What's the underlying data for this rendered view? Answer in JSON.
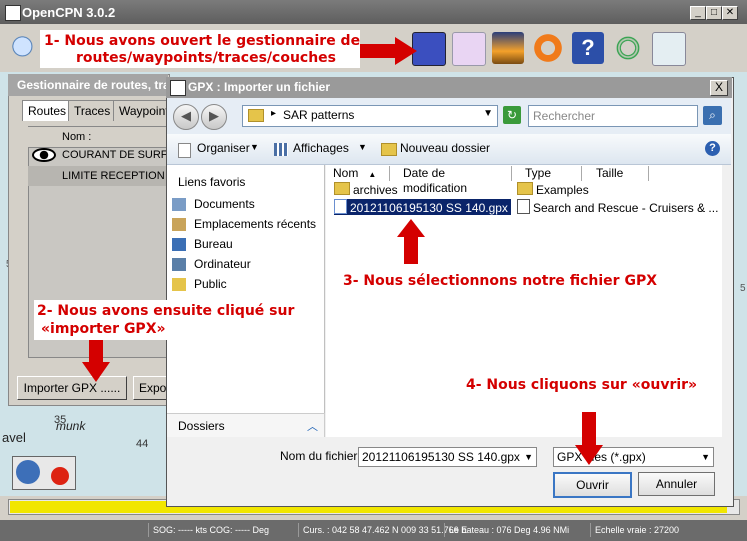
{
  "main_window": {
    "title": "OpenCPN 3.0.2",
    "chart_labels": [
      "35",
      "44",
      "avel",
      "munk",
      "5",
      "5"
    ]
  },
  "route_manager": {
    "title": "Gestionnaire de routes, tra",
    "tabs": [
      "Routes",
      "Traces",
      "Waypoint"
    ],
    "column_name": "Nom :",
    "rows": [
      "COURANT DE SURF...",
      "LIMITE RECEPTION ..."
    ],
    "import_button": "Importer GPX ......",
    "export_button": "Expo"
  },
  "dialog": {
    "title": "GPX : Importer un fichier",
    "close": "X",
    "address": "SAR patterns",
    "search_placeholder": "Rechercher",
    "commands": {
      "organize": "Organiser",
      "views": "Affichages",
      "new_folder": "Nouveau dossier"
    },
    "favorites_header": "Liens favoris",
    "favorites": [
      "Documents",
      "Emplacements récents",
      "Bureau",
      "Ordinateur",
      "Public"
    ],
    "folders_label": "Dossiers",
    "columns": [
      "Nom",
      "Date de modification",
      "Type",
      "Taille"
    ],
    "files": [
      {
        "name": "archives",
        "kind": "folder"
      },
      {
        "name": "Examples",
        "kind": "folder"
      },
      {
        "name": "20121106195130 SS 140.gpx",
        "kind": "gpx",
        "selected": true
      },
      {
        "name": "Search and Rescue - Cruisers & ...",
        "kind": "file"
      }
    ],
    "filename_label": "Nom du fichier :",
    "filename_value": "20121106195130 SS 140.gpx",
    "filetype_value": "GPX files (*.gpx)",
    "open_button": "Ouvrir",
    "cancel_button": "Annuler"
  },
  "status_bar": {
    "sog": "SOG: ----- kts  COG: ----- Deg",
    "position": "Curs. : 042 58 47.462 N 009 33 51.766 E",
    "boat": "Le  bateau : 076 Deg   4.96 NMi",
    "scale": "Echelle vraie :   27200"
  },
  "progress_fraction": 0.985,
  "annotations": {
    "step1_line1": "1- Nous avons ouvert le gestionnaire de",
    "step1_line2": "routes/waypoints/traces/couches",
    "step2_line1": "2- Nous avons ensuite cliqué sur",
    "step2_line2": "«importer GPX»",
    "step3": "3- Nous sélectionnons notre fichier GPX",
    "step4": "4- Nous cliquons sur «ouvrir»"
  },
  "colors": {
    "annotation": "#d40000",
    "selection": "#0a246a",
    "progress": "#f1e600"
  }
}
